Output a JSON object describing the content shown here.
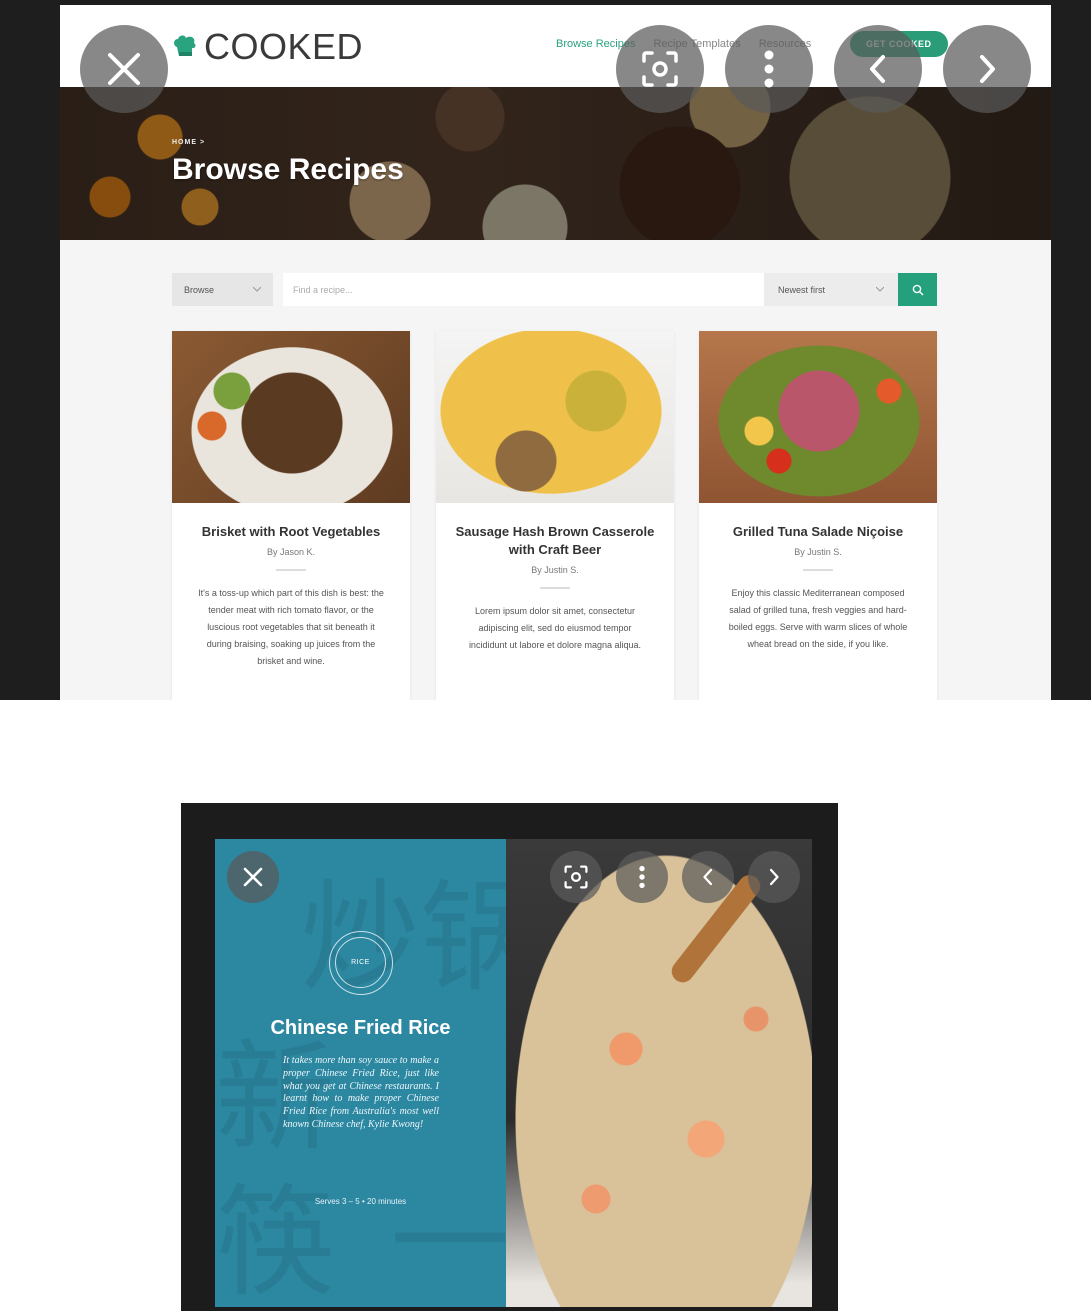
{
  "viewer1": {
    "site": {
      "logo_text": "COOKED",
      "nav": [
        "Browse Recipes",
        "Recipe Templates",
        "Resources"
      ],
      "cta": "GET COOKED"
    },
    "hero": {
      "breadcrumb": "HOME  >",
      "title": "Browse Recipes"
    },
    "search": {
      "browse_label": "Browse",
      "placeholder": "Find a recipe...",
      "sort_label": "Newest first"
    },
    "cards": [
      {
        "title": "Brisket with Root Vegetables",
        "author": "By Jason K.",
        "description": "It's a toss-up which part of this dish is best: the tender meat with rich tomato flavor, or the luscious root vegetables that sit beneath it during braising, soaking up juices from the brisket and wine."
      },
      {
        "title": "Sausage Hash Brown Casserole with Craft Beer",
        "author": "By Justin S.",
        "description": "Lorem ipsum dolor sit amet, consectetur adipiscing elit, sed do eiusmod tempor incididunt ut labore et dolore magna aliqua."
      },
      {
        "title": "Grilled Tuna Salade Niçoise",
        "author": "By Justin S.",
        "description": "Enjoy this classic Mediterranean composed salad of grilled tuna, fresh veggies and hard-boiled eggs. Serve with warm slices of whole wheat bread on the side, if you like."
      }
    ]
  },
  "viewer2": {
    "badge": "RICE",
    "title": "Chinese Fried Rice",
    "description": "It takes more than soy sauce to make a proper Chinese Fried Rice, just like what you get at Chinese restaurants. I learnt how to make proper Chinese Fried Rice from Australia's most well known Chinese chef, Kylie Kwong!",
    "meta": "Serves 3 – 5  •  20 minutes",
    "background_glyphs": [
      "炒",
      "锅",
      "新",
      "筷",
      "一"
    ]
  },
  "colors": {
    "brand_green": "#2a9d78",
    "panel_blue": "#2c87a1",
    "overlay_button": "#5a5a5a"
  },
  "icons": [
    "close-icon",
    "lens-icon",
    "more-vert-icon",
    "chevron-left-icon",
    "chevron-right-icon",
    "search-icon",
    "chef-hat-icon"
  ]
}
